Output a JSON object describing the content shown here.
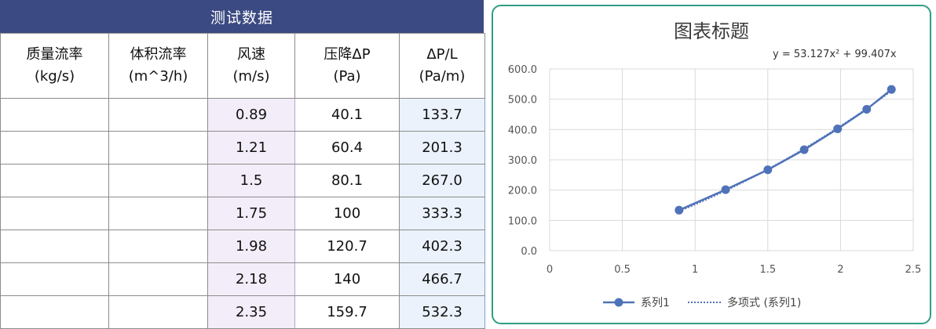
{
  "table": {
    "title": "测试数据",
    "headers": [
      [
        "质量流率",
        "(kg/s)"
      ],
      [
        "体积流率",
        "(m^3/h)"
      ],
      [
        "风速",
        "(m/s)"
      ],
      [
        "压降ΔP",
        "(Pa)"
      ],
      [
        "ΔP/L",
        "(Pa/m)"
      ]
    ],
    "rows": [
      [
        "",
        "",
        "0.89",
        "40.1",
        "133.7"
      ],
      [
        "",
        "",
        "1.21",
        "60.4",
        "201.3"
      ],
      [
        "",
        "",
        "1.5",
        "80.1",
        "267.0"
      ],
      [
        "",
        "",
        "1.75",
        "100",
        "333.3"
      ],
      [
        "",
        "",
        "1.98",
        "120.7",
        "402.3"
      ],
      [
        "",
        "",
        "2.18",
        "140",
        "466.7"
      ],
      [
        "",
        "",
        "2.35",
        "159.7",
        "532.3"
      ]
    ]
  },
  "chart_data": {
    "type": "scatter",
    "title": "图表标题",
    "xlabel": "",
    "ylabel": "",
    "xlim": [
      0,
      2.5
    ],
    "ylim": [
      0,
      600
    ],
    "xticks": [
      "0",
      "0.5",
      "1",
      "1.5",
      "2",
      "2.5"
    ],
    "yticks": [
      "0.0",
      "100.0",
      "200.0",
      "300.0",
      "400.0",
      "500.0",
      "600.0"
    ],
    "grid": true,
    "legend_position": "bottom",
    "series": [
      {
        "name": "系列1",
        "x": [
          0.89,
          1.21,
          1.5,
          1.75,
          1.98,
          2.18,
          2.35
        ],
        "y": [
          133.7,
          201.3,
          267.0,
          333.3,
          402.3,
          466.7,
          532.3
        ],
        "color": "#4f72b8"
      }
    ],
    "trendline": {
      "name": "多项式 (系列1)",
      "type": "polynomial",
      "equation": "y = 53.127x² + 99.407x",
      "coefficients": [
        53.127,
        99.407,
        0
      ],
      "color": "#4f72b8"
    },
    "legend": [
      "系列1",
      "多项式 (系列1)"
    ]
  }
}
